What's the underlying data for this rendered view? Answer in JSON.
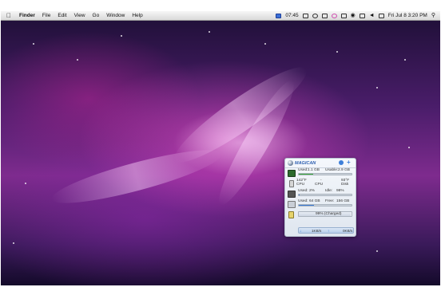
{
  "menubar": {
    "app_name": "Finder",
    "menus": [
      "File",
      "Edit",
      "View",
      "Go",
      "Window",
      "Help"
    ],
    "tray_time_short": "07:45",
    "clock": "Fri Jul 8  3:20 PM"
  },
  "widget": {
    "brand": "MAGICAN",
    "memory": {
      "used_label": "Used:",
      "used_value": "1.1 GB",
      "usable_label": "Usable:",
      "usable_value": "2.9 GB",
      "fill_fraction": 0.28
    },
    "temps": {
      "cpu_temp": "142°F",
      "cpu_label": "CPU",
      "mid_value": "-",
      "mid_label": "CPU",
      "disk_temp": "93°F",
      "disk_label": "Disk"
    },
    "cpu": {
      "used_label": "Used:",
      "used_value": "2%",
      "idle_label": "Idle:",
      "idle_value": "98%",
      "fill_fraction": 0.02
    },
    "disk": {
      "used_label": "Used:",
      "used_value": "64 GB",
      "free_label": "Free:",
      "free_value": "156 GB",
      "fill_fraction": 0.29
    },
    "battery": {
      "status": "99% (Charged)",
      "fill_fraction": 0.99
    },
    "network": {
      "down": "1KB/s",
      "up": "0KB/s"
    }
  }
}
